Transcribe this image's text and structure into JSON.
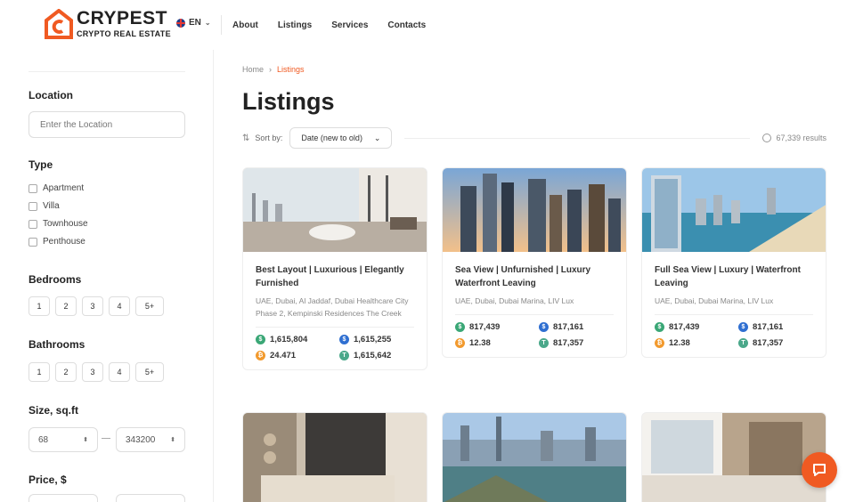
{
  "header": {
    "brand": "CRYPEST",
    "tagline": "CRYPTO REAL ESTATE",
    "lang": "EN",
    "nav": [
      "About",
      "Listings",
      "Services",
      "Contacts"
    ]
  },
  "sidebar": {
    "location_title": "Location",
    "location_placeholder": "Enter the Location",
    "type_title": "Type",
    "types": [
      "Apartment",
      "Villa",
      "Townhouse",
      "Penthouse"
    ],
    "bedrooms_title": "Bedrooms",
    "bedrooms": [
      "1",
      "2",
      "3",
      "4",
      "5+"
    ],
    "bathrooms_title": "Bathrooms",
    "bathrooms": [
      "1",
      "2",
      "3",
      "4",
      "5+"
    ],
    "size_title": "Size, sq.ft",
    "size_min": "68",
    "size_max": "343200",
    "price_title": "Price, $"
  },
  "main": {
    "breadcrumb_home": "Home",
    "breadcrumb_current": "Listings",
    "title": "Listings",
    "sort_label": "Sort by:",
    "sort_value": "Date (new to old)",
    "results": "67,339 results"
  },
  "listings": [
    {
      "title": "Best Layout | Luxurious | Elegantly Furnished",
      "address": "UAE, Dubai, Al Jaddaf, Dubai Healthcare City Phase 2, Kempinski Residences The Creek",
      "prices": {
        "usd": "1,615,804",
        "usdc": "1,615,255",
        "btc": "24.471",
        "usdt": "1,615,642"
      }
    },
    {
      "title": "Sea View | Unfurnished | Luxury Waterfront Leaving",
      "address": "UAE, Dubai, Dubai Marina, LIV Lux",
      "prices": {
        "usd": "817,439",
        "usdc": "817,161",
        "btc": "12.38",
        "usdt": "817,357"
      }
    },
    {
      "title": "Full Sea View | Luxury | Waterfront Leaving",
      "address": "UAE, Dubai, Dubai Marina, LIV Lux",
      "prices": {
        "usd": "817,439",
        "usdc": "817,161",
        "btc": "12.38",
        "usdt": "817,357"
      }
    }
  ],
  "colors": {
    "accent": "#f05a22",
    "usd": "#3aa776",
    "usdc": "#2f6fd1",
    "btc": "#f29a2e",
    "usdt": "#4aa88a"
  }
}
